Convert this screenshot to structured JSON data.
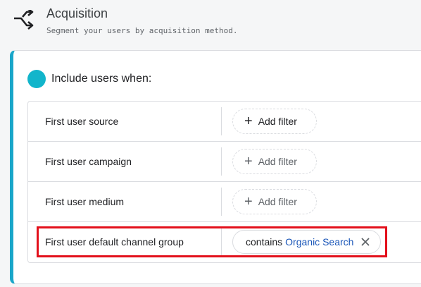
{
  "header": {
    "title": "Acquisition",
    "subtitle": "Segment your users by acquisition method.",
    "icon": "merge-arrows-icon"
  },
  "condition": {
    "label": "Include users when:",
    "accent_color": "#12b5cb"
  },
  "rows": [
    {
      "dimension": "First user source",
      "action": "Add filter",
      "active": true
    },
    {
      "dimension": "First user campaign",
      "action": "Add filter",
      "active": false
    },
    {
      "dimension": "First user medium",
      "action": "Add filter",
      "active": false
    },
    {
      "dimension": "First user default channel group",
      "filter": {
        "operator": "contains",
        "value": "Organic Search"
      }
    }
  ],
  "highlight_color": "#e3101b"
}
